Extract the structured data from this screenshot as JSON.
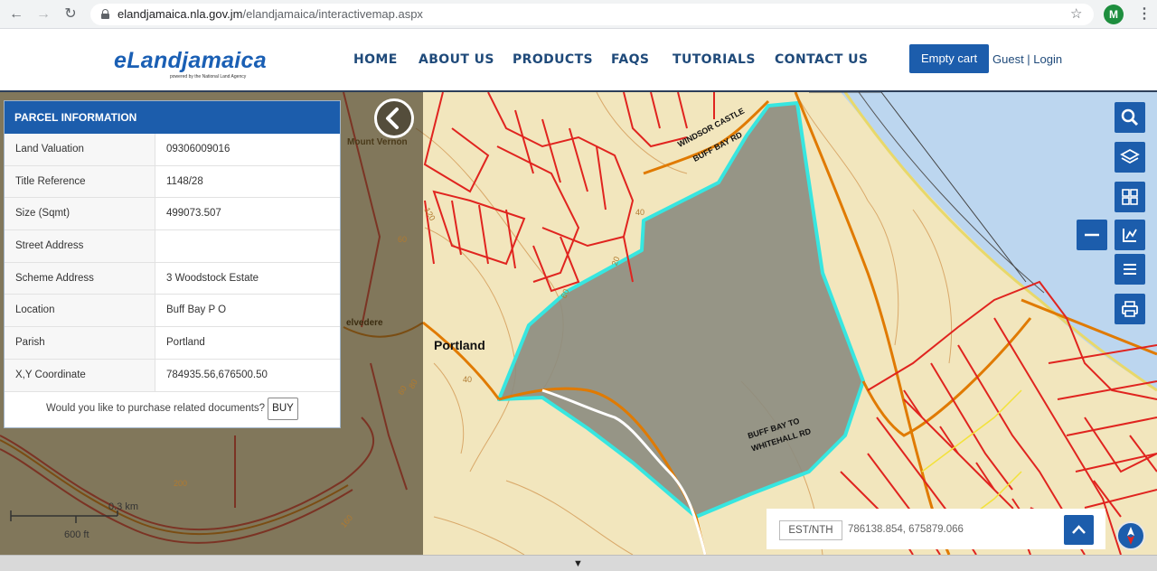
{
  "browser": {
    "url_host": "elandjamaica.nla.gov.jm",
    "url_path": "/elandjamaica/interactivemap.aspx",
    "profile_initial": "M",
    "back_glyph": "←",
    "forward_glyph": "→",
    "reload_glyph": "↻",
    "star_glyph": "☆",
    "menu_glyph": "⋮"
  },
  "header": {
    "logo": "eLandjamaica",
    "logo_tagline": "powered by the National Land Agency",
    "nav": [
      "HOME",
      "ABOUT US",
      "PRODUCTS",
      "FAQS",
      "TUTORIALS",
      "CONTACT US"
    ],
    "cart_label": "Empty cart",
    "login_text": "Guest | Login"
  },
  "parcel": {
    "title": "PARCEL INFORMATION",
    "rows": [
      {
        "label": "Land Valuation",
        "value": "09306009016"
      },
      {
        "label": "Title Reference",
        "value": "1148/28"
      },
      {
        "label": "Size (Sqmt)",
        "value": "499073.507"
      },
      {
        "label": "Street Address",
        "value": ""
      },
      {
        "label": "Scheme Address",
        "value": "3 Woodstock Estate"
      },
      {
        "label": "Location",
        "value": "Buff Bay P O"
      },
      {
        "label": "Parish",
        "value": "Portland"
      },
      {
        "label": "X,Y Coordinate",
        "value": "784935.56,676500.50"
      }
    ],
    "purchase_question": "Would you like to purchase related documents?",
    "buy_label": "BUY"
  },
  "map": {
    "labels": {
      "portland": "Portland",
      "belvedere": "elvedere",
      "mount_vernon": "Mount Vernon",
      "windsor_1": "WINDSOR CASTLE",
      "windsor_2": "BUFF BAY RD",
      "buffbay_1": "BUFF BAY TO",
      "buffbay_2": "WHITEHALL RD",
      "contour_200": "200",
      "contour_120": "120",
      "contour_60a": "60",
      "contour_40a": "40",
      "contour_20": "20",
      "contour_60b": "60",
      "contour_40b": "40",
      "contour_60c": "60",
      "contour_80": "80",
      "contour_160": "160"
    },
    "tools": [
      "search-icon",
      "layers-icon",
      "basemap-icon",
      "measure-icon",
      "list-icon",
      "print-icon"
    ],
    "minus_tool": "zoom-out-icon",
    "scale_km": "0.3 km",
    "scale_ft": "600 ft",
    "coord_label": "EST/NTH",
    "coord_value": "786138.854, 675879.066",
    "colors": {
      "accent": "#1c5dac",
      "parcel_outline": "#37e6e0",
      "road": "#e07a00",
      "boundary": "#e0241f",
      "water": "#bcd6ef"
    }
  },
  "bottom": {
    "toggle_glyph": "▼"
  }
}
